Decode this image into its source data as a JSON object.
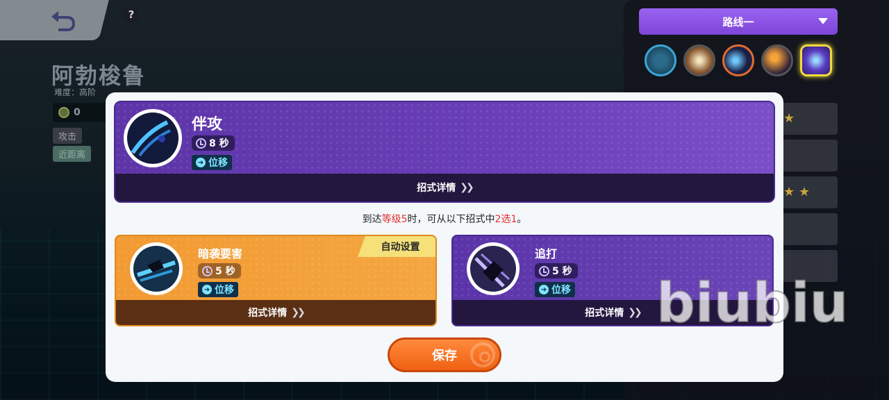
{
  "header": {
    "help_label": "?"
  },
  "pokemon": {
    "name": "阿勃梭鲁",
    "difficulty": "难度：高阶",
    "emblem_count": "0",
    "tags": [
      "攻击",
      "近距离"
    ]
  },
  "route_select": {
    "label": "路线一"
  },
  "skill_icons": [
    "passive-icon",
    "attack-icon",
    "skill-1-icon",
    "skill-2-icon",
    "unite-icon"
  ],
  "main_move": {
    "name": "伴攻",
    "cooldown": "8 秒",
    "type": "位移",
    "detail_label": "招式详情"
  },
  "instruction": {
    "part1": "到达",
    "level": "等级5",
    "part2": "时，可从以下招式中",
    "choice": "2选1",
    "part3": "。"
  },
  "options": [
    {
      "name": "暗袭要害",
      "cooldown": "5 秒",
      "type": "位移",
      "detail_label": "招式详情",
      "badge": "自动设置"
    },
    {
      "name": "追打",
      "cooldown": "5 秒",
      "type": "位移",
      "detail_label": "招式详情"
    }
  ],
  "save_label": "保存",
  "watermark": "biubiu",
  "colors": {
    "accent_purple": "#6a3fb8",
    "accent_orange": "#f29a33",
    "save_orange": "#f06012",
    "highlight_red": "#e5302f"
  }
}
